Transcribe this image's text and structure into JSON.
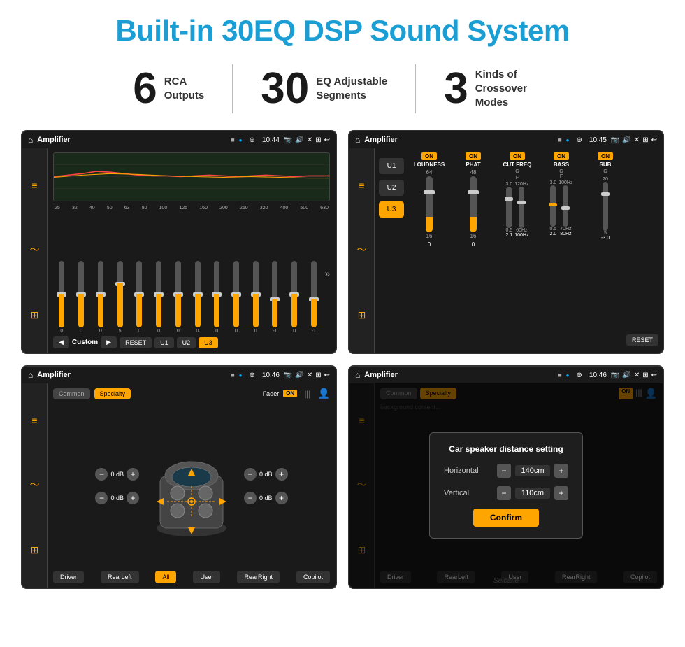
{
  "title": "Built-in 30EQ DSP Sound System",
  "stats": [
    {
      "number": "6",
      "text": "RCA\nOutputs"
    },
    {
      "number": "30",
      "text": "EQ Adjustable\nSegments"
    },
    {
      "number": "3",
      "text": "Kinds of\nCrossover Modes"
    }
  ],
  "screen1": {
    "header": {
      "title": "Amplifier",
      "time": "10:44"
    },
    "eq_labels": [
      "25",
      "32",
      "40",
      "50",
      "63",
      "80",
      "100",
      "125",
      "160",
      "200",
      "250",
      "320",
      "400",
      "500",
      "630"
    ],
    "eq_values": [
      "0",
      "0",
      "0",
      "5",
      "0",
      "0",
      "0",
      "0",
      "0",
      "0",
      "0",
      "-1",
      "0",
      "-1"
    ],
    "bottom_controls": [
      "Custom",
      "RESET",
      "U1",
      "U2",
      "U3"
    ]
  },
  "screen2": {
    "header": {
      "title": "Amplifier",
      "time": "10:45"
    },
    "u_buttons": [
      "U1",
      "U2",
      "U3"
    ],
    "active_u": "U3",
    "columns": [
      {
        "on": true,
        "title": "LOUDNESS",
        "sub": ""
      },
      {
        "on": true,
        "title": "PHAT",
        "sub": ""
      },
      {
        "on": true,
        "title": "CUT FREQ",
        "sub": "G\nF"
      },
      {
        "on": true,
        "title": "BASS",
        "sub": "G\nF"
      },
      {
        "on": true,
        "title": "SUB",
        "sub": "G"
      }
    ],
    "reset_btn": "RESET"
  },
  "screen3": {
    "header": {
      "title": "Amplifier",
      "time": "10:46"
    },
    "tabs": [
      "Common",
      "Specialty"
    ],
    "fader_label": "Fader",
    "on_label": "ON",
    "vol_labels": [
      "0 dB",
      "0 dB",
      "0 dB",
      "0 dB"
    ],
    "bottom_buttons": [
      "Driver",
      "RearLeft",
      "All",
      "User",
      "RearRight",
      "Copilot"
    ]
  },
  "screen4": {
    "header": {
      "title": "Amplifier",
      "time": "10:46"
    },
    "tabs": [
      "Common",
      "Specialty"
    ],
    "dialog": {
      "title": "Car speaker distance setting",
      "horizontal_label": "Horizontal",
      "horizontal_value": "140cm",
      "vertical_label": "Vertical",
      "vertical_value": "110cm",
      "confirm_label": "Confirm"
    },
    "bottom_buttons": [
      "Driver",
      "RearLeft",
      "User",
      "RearRight",
      "Copilot"
    ]
  },
  "watermark": "Seicane"
}
